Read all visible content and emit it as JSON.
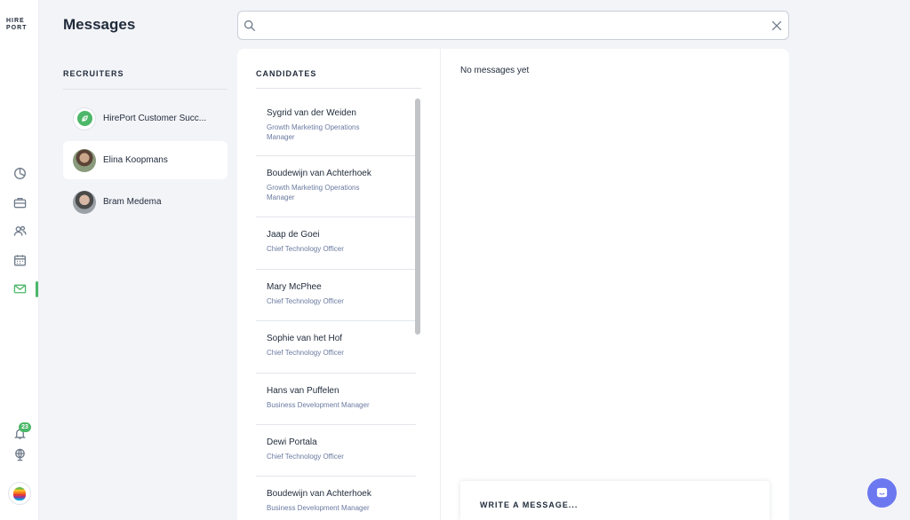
{
  "app": {
    "logo_line1": "HIRE",
    "logo_line2": "PORT"
  },
  "header": {
    "title": "Messages",
    "search_placeholder": ""
  },
  "sidebar": {
    "items": [
      {
        "icon": "dashboard-icon"
      },
      {
        "icon": "briefcase-icon"
      },
      {
        "icon": "people-icon"
      },
      {
        "icon": "calendar-icon"
      },
      {
        "icon": "mail-icon",
        "active": true
      }
    ],
    "notifications_count": "23",
    "accent_color": "#4cb769"
  },
  "recruiters": {
    "title": "RECRUITERS",
    "items": [
      {
        "name": "HirePort Customer Succ..."
      },
      {
        "name": "Elina Koopmans",
        "selected": true
      },
      {
        "name": "Bram Medema"
      }
    ]
  },
  "candidates": {
    "title": "CANDIDATES",
    "items": [
      {
        "name": "Sygrid van der Weiden",
        "role": "Growth Marketing Operations Manager"
      },
      {
        "name": "Boudewijn van Achterhoek",
        "role": "Growth Marketing Operations Manager"
      },
      {
        "name": "Jaap de Goei",
        "role": "Chief Technology Officer"
      },
      {
        "name": "Mary McPhee",
        "role": "Chief Technology Officer"
      },
      {
        "name": "Sophie van het Hof",
        "role": "Chief Technology Officer"
      },
      {
        "name": "Hans van Puffelen",
        "role": "Business Development Manager"
      },
      {
        "name": "Dewi Portala",
        "role": "Chief Technology Officer"
      },
      {
        "name": "Boudewijn van Achterhoek",
        "role": "Business Development Manager"
      }
    ]
  },
  "conversation": {
    "empty_text": "No messages yet",
    "composer_label": "WRITE A MESSAGE..."
  }
}
